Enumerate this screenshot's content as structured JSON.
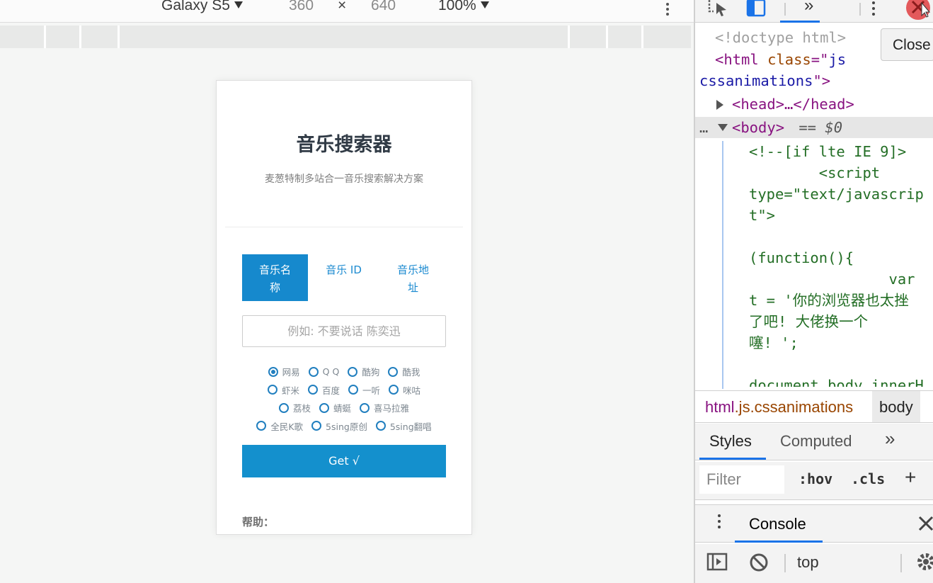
{
  "device_toolbar": {
    "device": "Galaxy S5",
    "width": "360",
    "times": "×",
    "height": "640",
    "zoom": "100%"
  },
  "app": {
    "title": "音乐搜索器",
    "subtitle": "麦葱特制多站合一音乐搜索解决方案",
    "tabs": [
      {
        "line1": "音乐名",
        "line2": "称",
        "active": true
      },
      {
        "line1": "音乐 ID",
        "line2": "",
        "active": false
      },
      {
        "line1": "音乐地",
        "line2": "址",
        "active": false
      }
    ],
    "search_placeholder": "例如: 不要说话 陈奕迅",
    "sources": [
      [
        "网易",
        "Q Q",
        "酷狗",
        "酷我"
      ],
      [
        "虾米",
        "百度",
        "一听",
        "咪咕"
      ],
      [
        "荔枝",
        "蜻蜓",
        "喜马拉雅"
      ],
      [
        "全民K歌",
        "5sing原创",
        "5sing翻唱"
      ]
    ],
    "get_button": "Get √",
    "help_label": "帮助："
  },
  "devtools": {
    "close_tooltip": "Close",
    "code_lines": {
      "l0": "<!doctype html>",
      "l1_tag_open": "<html ",
      "l1_attr": "class",
      "l1_eq": "=\"",
      "l1_val": "js",
      "l2_val": "cssanimations",
      "l2_end": "\">",
      "l3": "<head>…</head>",
      "l4_tag": "<body>",
      "l4_eq": " == $0",
      "l5": "<!--[if lte IE 9]>",
      "l6": "        <script",
      "l7": "type=\"text/javascrip",
      "l8": "t\">",
      "l9": "",
      "l10": "(function(){",
      "l11": "                var",
      "l12": "t = '你的浏览器也太挫",
      "l13": "了吧! 大佬换一个",
      "l14": "噻! ';",
      "l15": "",
      "l16": "document.body.innerH"
    },
    "breadcrumb_html": "html",
    "breadcrumb_rest": ".js.cssanimations",
    "breadcrumb_body": "body",
    "styles_tab": "Styles",
    "computed_tab": "Computed",
    "more_tabs": "»",
    "filter_placeholder": "Filter",
    "hov": ":hov",
    "cls": ".cls",
    "plus": "+",
    "console_tab": "Console",
    "context": "top"
  }
}
